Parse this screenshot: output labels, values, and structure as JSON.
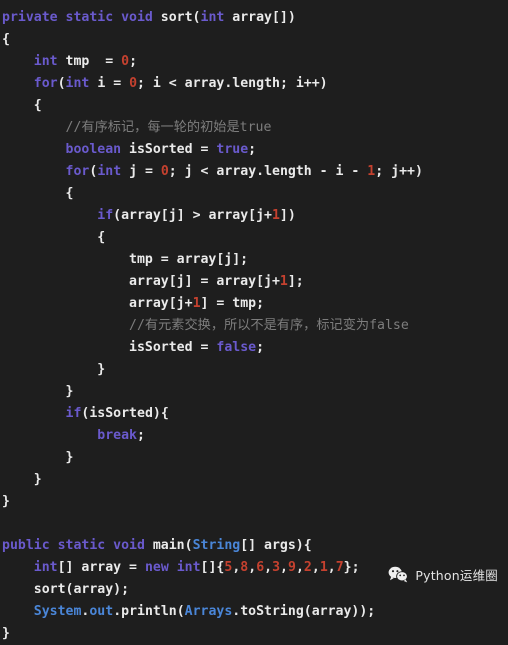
{
  "editor": {
    "background_color": "#1e1e1e",
    "keyword_color": "#6a5acd",
    "type_color": "#4a86d8",
    "number_color": "#c5412f",
    "comment_color": "#7d7d7d",
    "plain_color": "#eaeaea",
    "language": "Java"
  },
  "code": {
    "lines": [
      {
        "id": "line-1",
        "tokens": [
          {
            "t": "kw",
            "v": "private static void "
          },
          {
            "t": "plain",
            "v": "sort("
          },
          {
            "t": "kw",
            "v": "int"
          },
          {
            "t": "plain",
            "v": " array[])"
          }
        ]
      },
      {
        "id": "line-2",
        "tokens": [
          {
            "t": "plain",
            "v": "{"
          }
        ]
      },
      {
        "id": "line-3",
        "tokens": [
          {
            "t": "plain",
            "v": "    "
          },
          {
            "t": "kw",
            "v": "int"
          },
          {
            "t": "plain",
            "v": " tmp  = "
          },
          {
            "t": "num",
            "v": "0"
          },
          {
            "t": "plain",
            "v": ";"
          }
        ]
      },
      {
        "id": "line-4",
        "tokens": [
          {
            "t": "plain",
            "v": "    "
          },
          {
            "t": "kw",
            "v": "for"
          },
          {
            "t": "plain",
            "v": "("
          },
          {
            "t": "kw",
            "v": "int"
          },
          {
            "t": "plain",
            "v": " i = "
          },
          {
            "t": "num",
            "v": "0"
          },
          {
            "t": "plain",
            "v": "; i < array.length; i++)"
          }
        ]
      },
      {
        "id": "line-5",
        "tokens": [
          {
            "t": "plain",
            "v": "    {"
          }
        ]
      },
      {
        "id": "line-6",
        "tokens": [
          {
            "t": "plain",
            "v": "        "
          },
          {
            "t": "comment",
            "v": "//有序标记，每一轮的初始是true"
          }
        ]
      },
      {
        "id": "line-7",
        "tokens": [
          {
            "t": "plain",
            "v": "        "
          },
          {
            "t": "kw",
            "v": "boolean"
          },
          {
            "t": "plain",
            "v": " isSorted = "
          },
          {
            "t": "kw",
            "v": "true"
          },
          {
            "t": "plain",
            "v": ";"
          }
        ]
      },
      {
        "id": "line-8",
        "tokens": [
          {
            "t": "plain",
            "v": "        "
          },
          {
            "t": "kw",
            "v": "for"
          },
          {
            "t": "plain",
            "v": "("
          },
          {
            "t": "kw",
            "v": "int"
          },
          {
            "t": "plain",
            "v": " j = "
          },
          {
            "t": "num",
            "v": "0"
          },
          {
            "t": "plain",
            "v": "; j < array.length - i - "
          },
          {
            "t": "num",
            "v": "1"
          },
          {
            "t": "plain",
            "v": "; j++)"
          }
        ]
      },
      {
        "id": "line-9",
        "tokens": [
          {
            "t": "plain",
            "v": "        {"
          }
        ]
      },
      {
        "id": "line-10",
        "tokens": [
          {
            "t": "plain",
            "v": "            "
          },
          {
            "t": "kw",
            "v": "if"
          },
          {
            "t": "plain",
            "v": "(array[j] > array[j+"
          },
          {
            "t": "num",
            "v": "1"
          },
          {
            "t": "plain",
            "v": "])"
          }
        ]
      },
      {
        "id": "line-11",
        "tokens": [
          {
            "t": "plain",
            "v": "            {"
          }
        ]
      },
      {
        "id": "line-12",
        "tokens": [
          {
            "t": "plain",
            "v": "                tmp = array[j];"
          }
        ]
      },
      {
        "id": "line-13",
        "tokens": [
          {
            "t": "plain",
            "v": "                array[j] = array[j+"
          },
          {
            "t": "num",
            "v": "1"
          },
          {
            "t": "plain",
            "v": "];"
          }
        ]
      },
      {
        "id": "line-14",
        "tokens": [
          {
            "t": "plain",
            "v": "                array[j+"
          },
          {
            "t": "num",
            "v": "1"
          },
          {
            "t": "plain",
            "v": "] = tmp;"
          }
        ]
      },
      {
        "id": "line-15",
        "tokens": [
          {
            "t": "plain",
            "v": "                "
          },
          {
            "t": "comment",
            "v": "//有元素交换，所以不是有序，标记变为false"
          }
        ]
      },
      {
        "id": "line-16",
        "tokens": [
          {
            "t": "plain",
            "v": "                isSorted = "
          },
          {
            "t": "kw",
            "v": "false"
          },
          {
            "t": "plain",
            "v": ";"
          }
        ]
      },
      {
        "id": "line-17",
        "tokens": [
          {
            "t": "plain",
            "v": "            }"
          }
        ]
      },
      {
        "id": "line-18",
        "tokens": [
          {
            "t": "plain",
            "v": "        }"
          }
        ]
      },
      {
        "id": "line-19",
        "tokens": [
          {
            "t": "plain",
            "v": "        "
          },
          {
            "t": "kw",
            "v": "if"
          },
          {
            "t": "plain",
            "v": "(isSorted){"
          }
        ]
      },
      {
        "id": "line-20",
        "tokens": [
          {
            "t": "plain",
            "v": "            "
          },
          {
            "t": "kw",
            "v": "break"
          },
          {
            "t": "plain",
            "v": ";"
          }
        ]
      },
      {
        "id": "line-21",
        "tokens": [
          {
            "t": "plain",
            "v": "        }"
          }
        ]
      },
      {
        "id": "line-22",
        "tokens": [
          {
            "t": "plain",
            "v": "    }"
          }
        ]
      },
      {
        "id": "line-23",
        "tokens": [
          {
            "t": "plain",
            "v": "}"
          }
        ]
      },
      {
        "id": "line-24",
        "tokens": [
          {
            "t": "plain",
            "v": ""
          }
        ]
      },
      {
        "id": "line-25",
        "tokens": [
          {
            "t": "kw",
            "v": "public static void "
          },
          {
            "t": "plain",
            "v": "main("
          },
          {
            "t": "type",
            "v": "String"
          },
          {
            "t": "plain",
            "v": "[] args){"
          }
        ]
      },
      {
        "id": "line-26",
        "tokens": [
          {
            "t": "plain",
            "v": "    "
          },
          {
            "t": "kw",
            "v": "int"
          },
          {
            "t": "plain",
            "v": "[] array = "
          },
          {
            "t": "kw",
            "v": "new"
          },
          {
            "t": "plain",
            "v": " "
          },
          {
            "t": "kw",
            "v": "int"
          },
          {
            "t": "plain",
            "v": "[]{"
          },
          {
            "t": "num",
            "v": "5"
          },
          {
            "t": "plain",
            "v": ","
          },
          {
            "t": "num",
            "v": "8"
          },
          {
            "t": "plain",
            "v": ","
          },
          {
            "t": "num",
            "v": "6"
          },
          {
            "t": "plain",
            "v": ","
          },
          {
            "t": "num",
            "v": "3"
          },
          {
            "t": "plain",
            "v": ","
          },
          {
            "t": "num",
            "v": "9"
          },
          {
            "t": "plain",
            "v": ","
          },
          {
            "t": "num",
            "v": "2"
          },
          {
            "t": "plain",
            "v": ","
          },
          {
            "t": "num",
            "v": "1"
          },
          {
            "t": "plain",
            "v": ","
          },
          {
            "t": "num",
            "v": "7"
          },
          {
            "t": "plain",
            "v": "};"
          }
        ]
      },
      {
        "id": "line-27",
        "tokens": [
          {
            "t": "plain",
            "v": "    sort(array);"
          }
        ]
      },
      {
        "id": "line-28",
        "tokens": [
          {
            "t": "plain",
            "v": "    "
          },
          {
            "t": "type",
            "v": "System"
          },
          {
            "t": "plain",
            "v": "."
          },
          {
            "t": "member",
            "v": "out"
          },
          {
            "t": "plain",
            "v": ".println("
          },
          {
            "t": "type",
            "v": "Arrays"
          },
          {
            "t": "plain",
            "v": ".toString(array));"
          }
        ]
      },
      {
        "id": "line-29",
        "tokens": [
          {
            "t": "plain",
            "v": "}"
          }
        ]
      }
    ]
  },
  "watermark": {
    "icon": "wechat-icon",
    "label": "Python运维圈"
  }
}
